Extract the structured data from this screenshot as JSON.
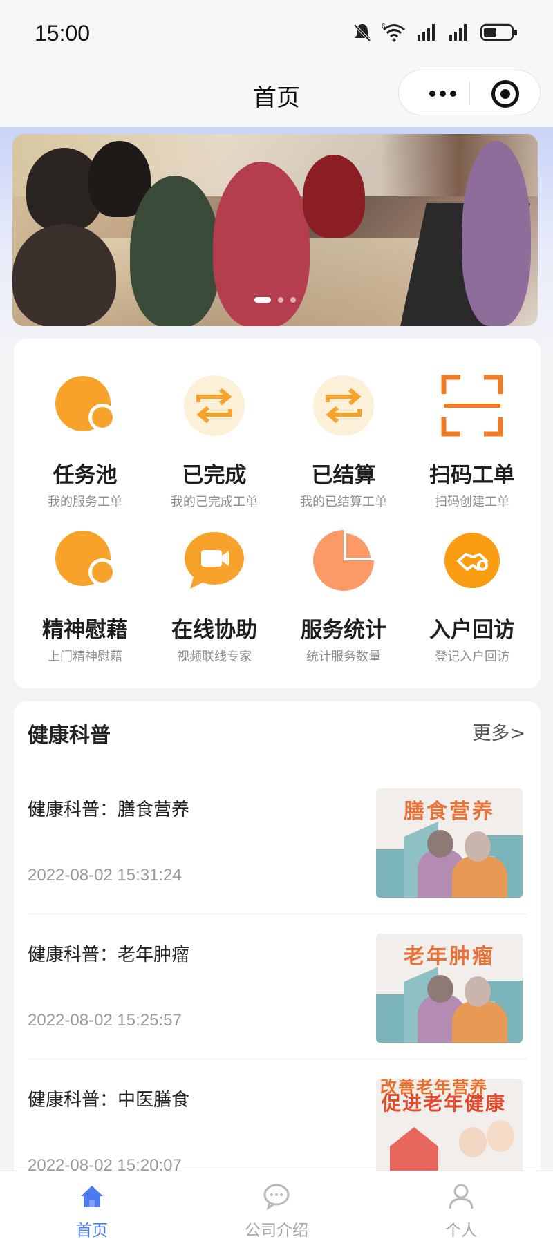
{
  "status_bar": {
    "time": "15:00",
    "icons": [
      "mute-icon",
      "wifi-icon",
      "signal-icon",
      "signal-icon",
      "battery-icon"
    ],
    "wifi_label": "6"
  },
  "nav": {
    "title": "首页",
    "capsule": [
      "more-icon",
      "close-target-icon"
    ]
  },
  "banner": {
    "slide_count": 3,
    "active_slide": 1
  },
  "grid": [
    {
      "title": "任务池",
      "sub": "我的服务工单",
      "icon": "task-pool-icon"
    },
    {
      "title": "已完成",
      "sub": "我的已完成工单",
      "icon": "completed-icon"
    },
    {
      "title": "已结算",
      "sub": "我的已结算工单",
      "icon": "settled-icon"
    },
    {
      "title": "扫码工单",
      "sub": "扫码创建工单",
      "icon": "scan-icon"
    },
    {
      "title": "精神慰藉",
      "sub": "上门精神慰藉",
      "icon": "comfort-icon"
    },
    {
      "title": "在线协助",
      "sub": "视频联线专家",
      "icon": "video-call-icon"
    },
    {
      "title": "服务统计",
      "sub": "统计服务数量",
      "icon": "pie-chart-icon"
    },
    {
      "title": "入户回访",
      "sub": "登记入户回访",
      "icon": "handshake-icon"
    }
  ],
  "health": {
    "title": "健康科普",
    "more": "更多>",
    "articles": [
      {
        "title": "健康科普：膳食营养",
        "time": "2022-08-02 15:31:24",
        "thumb_text": "膳食营养"
      },
      {
        "title": "健康科普：老年肿瘤",
        "time": "2022-08-02 15:25:57",
        "thumb_text": "老年肿瘤"
      },
      {
        "title": "健康科普：中医膳食",
        "time": "2022-08-02 15:20:07",
        "thumb_line1": "改善老年营养",
        "thumb_line2": "促进老年健康"
      }
    ]
  },
  "tabs": [
    {
      "label": "首页",
      "icon": "home-icon",
      "active": true
    },
    {
      "label": "公司介绍",
      "icon": "chat-icon",
      "active": false
    },
    {
      "label": "个人",
      "icon": "person-icon",
      "active": false
    }
  ],
  "colors": {
    "accent_orange": "#f7a22a",
    "accent_blue": "#4a7cf0",
    "tab_inactive": "#a8a8a8"
  }
}
